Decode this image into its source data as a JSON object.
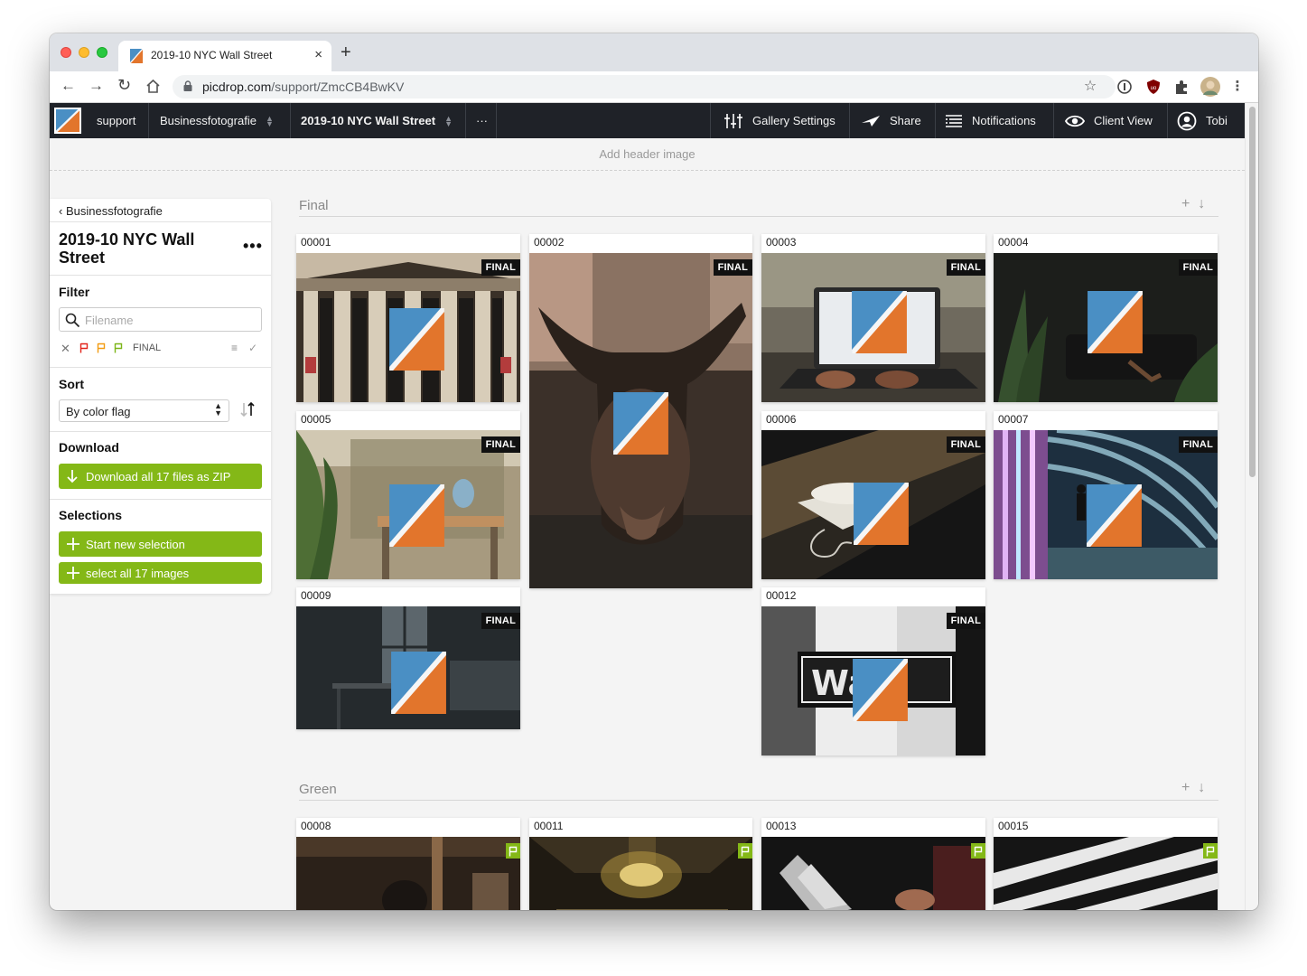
{
  "browser": {
    "tab_title": "2019-10 NYC Wall Street",
    "tab_close": "×",
    "new_tab": "+",
    "url_host": "picdrop.com",
    "url_path": "/support/ZmcCB4BwKV"
  },
  "appbar": {
    "account": "support",
    "folder": "Businessfotografie",
    "gallery": "2019-10 NYC Wall Street",
    "more": "···",
    "gallery_settings": "Gallery Settings",
    "share": "Share",
    "notifications": "Notifications",
    "client_view": "Client View",
    "user": "Tobi"
  },
  "header_image_label": "Add header image",
  "sidebar": {
    "back_label": "Businessfotografie",
    "title": "2019-10 NYC Wall Street",
    "more": "•••",
    "filter_heading": "Filter",
    "filename_placeholder": "Filename",
    "filter_final_label": "FINAL",
    "sort_heading": "Sort",
    "sort_value": "By color flag",
    "download_heading": "Download",
    "download_button": "Download all 17 files as ZIP",
    "selections_heading": "Selections",
    "new_selection_button": "Start new selection",
    "select_all_button": "select all 17 images"
  },
  "sections": [
    {
      "title": "Final",
      "items": [
        {
          "filename": "00001",
          "badge": "FINAL"
        },
        {
          "filename": "00002",
          "badge": "FINAL"
        },
        {
          "filename": "00003",
          "badge": "FINAL"
        },
        {
          "filename": "00004",
          "badge": "FINAL"
        },
        {
          "filename": "00005",
          "badge": "FINAL"
        },
        {
          "filename": "00006",
          "badge": "FINAL"
        },
        {
          "filename": "00007",
          "badge": "FINAL"
        },
        {
          "filename": "00009",
          "badge": "FINAL"
        },
        {
          "filename": "00012",
          "badge": "FINAL"
        }
      ]
    },
    {
      "title": "Green",
      "items": [
        {
          "filename": "00008",
          "flag": "green"
        },
        {
          "filename": "00011",
          "flag": "green"
        },
        {
          "filename": "00013",
          "flag": "green"
        },
        {
          "filename": "00015",
          "flag": "green"
        }
      ]
    }
  ],
  "colors": {
    "accent_green": "#84b817",
    "appbar_bg": "#1f2228",
    "flag_red": "#e2231a",
    "flag_orange": "#f39c12",
    "flag_green": "#7cb518"
  }
}
